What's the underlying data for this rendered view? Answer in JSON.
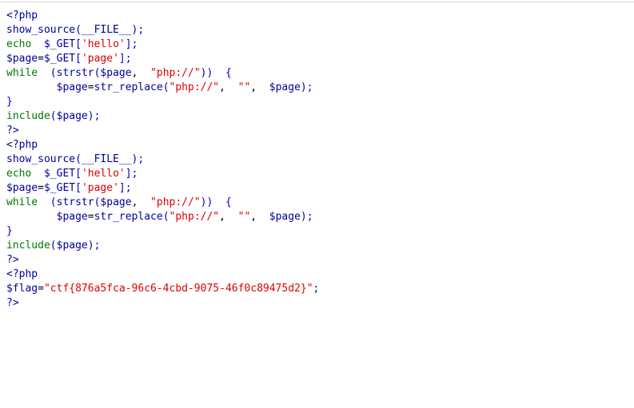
{
  "page": {
    "background_color": "#ffffff",
    "top_rule_color": "#d9d9d9"
  },
  "syntax_colors": {
    "php_tag": "#000099",
    "keyword": "#007700",
    "string": "#DD0000",
    "default": "#000099",
    "punctuation": "#0000BB",
    "plain": "#000000"
  },
  "source": {
    "language": "php",
    "flag": "ctf{876a5fca-96c6-4cbd-9075-46f0c89475d2}",
    "lines": [
      {
        "name": "php-open-tag-1",
        "tokens": [
          {
            "t": "<?php",
            "c": "tag"
          }
        ]
      },
      {
        "name": "show-source-call-1",
        "tokens": [
          {
            "t": "show_source",
            "c": "default"
          },
          {
            "t": "(",
            "c": "punct"
          },
          {
            "t": "__FILE__",
            "c": "default"
          },
          {
            "t": ")",
            "c": "punct"
          },
          {
            "t": ";",
            "c": "punct"
          }
        ]
      },
      {
        "name": "echo-hello-1",
        "tokens": [
          {
            "t": "echo ",
            "c": "keyword"
          },
          {
            "t": " ",
            "c": "plain"
          },
          {
            "t": "$_GET",
            "c": "default"
          },
          {
            "t": "[",
            "c": "punct"
          },
          {
            "t": "'hello'",
            "c": "string"
          },
          {
            "t": "]",
            "c": "punct"
          },
          {
            "t": ";",
            "c": "punct"
          }
        ]
      },
      {
        "name": "assign-page-1",
        "tokens": [
          {
            "t": "$page",
            "c": "default"
          },
          {
            "t": "=",
            "c": "plain"
          },
          {
            "t": "$_GET",
            "c": "default"
          },
          {
            "t": "[",
            "c": "punct"
          },
          {
            "t": "'page'",
            "c": "string"
          },
          {
            "t": "]",
            "c": "punct"
          },
          {
            "t": ";",
            "c": "punct"
          }
        ]
      },
      {
        "name": "while-strstr-1",
        "tokens": [
          {
            "t": "while",
            "c": "keyword"
          },
          {
            "t": " ",
            "c": "plain"
          },
          {
            "t": " (",
            "c": "punct"
          },
          {
            "t": "strstr",
            "c": "default"
          },
          {
            "t": "(",
            "c": "punct"
          },
          {
            "t": "$page",
            "c": "default"
          },
          {
            "t": ",",
            "c": "plain"
          },
          {
            "t": "  ",
            "c": "plain"
          },
          {
            "t": "\"php://\"",
            "c": "string"
          },
          {
            "t": "))",
            "c": "punct"
          },
          {
            "t": "  ",
            "c": "plain"
          },
          {
            "t": "{",
            "c": "punct"
          }
        ]
      },
      {
        "name": "str-replace-1",
        "indent": 4,
        "tokens": [
          {
            "t": "$page",
            "c": "default"
          },
          {
            "t": "=",
            "c": "plain"
          },
          {
            "t": "str_replace",
            "c": "default"
          },
          {
            "t": "(",
            "c": "punct"
          },
          {
            "t": "\"php://\"",
            "c": "string"
          },
          {
            "t": ",",
            "c": "plain"
          },
          {
            "t": "  ",
            "c": "plain"
          },
          {
            "t": "\"\"",
            "c": "string"
          },
          {
            "t": ",",
            "c": "plain"
          },
          {
            "t": "  ",
            "c": "plain"
          },
          {
            "t": "$page",
            "c": "default"
          },
          {
            "t": ")",
            "c": "punct"
          },
          {
            "t": ";",
            "c": "punct"
          }
        ]
      },
      {
        "name": "close-brace-1",
        "tokens": [
          {
            "t": "}",
            "c": "punct"
          }
        ]
      },
      {
        "name": "include-page-1",
        "tokens": [
          {
            "t": "include",
            "c": "keyword"
          },
          {
            "t": "(",
            "c": "punct"
          },
          {
            "t": "$page",
            "c": "default"
          },
          {
            "t": ")",
            "c": "punct"
          },
          {
            "t": ";",
            "c": "punct"
          }
        ]
      },
      {
        "name": "php-close-tag-1",
        "tokens": [
          {
            "t": "?>",
            "c": "tag"
          }
        ]
      },
      {
        "name": "php-open-tag-2",
        "tokens": [
          {
            "t": "<?php",
            "c": "tag"
          }
        ]
      },
      {
        "name": "show-source-call-2",
        "tokens": [
          {
            "t": "show_source",
            "c": "default"
          },
          {
            "t": "(",
            "c": "punct"
          },
          {
            "t": "__FILE__",
            "c": "default"
          },
          {
            "t": ")",
            "c": "punct"
          },
          {
            "t": ";",
            "c": "punct"
          }
        ]
      },
      {
        "name": "echo-hello-2",
        "tokens": [
          {
            "t": "echo ",
            "c": "keyword"
          },
          {
            "t": " ",
            "c": "plain"
          },
          {
            "t": "$_GET",
            "c": "default"
          },
          {
            "t": "[",
            "c": "punct"
          },
          {
            "t": "'hello'",
            "c": "string"
          },
          {
            "t": "]",
            "c": "punct"
          },
          {
            "t": ";",
            "c": "punct"
          }
        ]
      },
      {
        "name": "assign-page-2",
        "tokens": [
          {
            "t": "$page",
            "c": "default"
          },
          {
            "t": "=",
            "c": "plain"
          },
          {
            "t": "$_GET",
            "c": "default"
          },
          {
            "t": "[",
            "c": "punct"
          },
          {
            "t": "'page'",
            "c": "string"
          },
          {
            "t": "]",
            "c": "punct"
          },
          {
            "t": ";",
            "c": "punct"
          }
        ]
      },
      {
        "name": "while-strstr-2",
        "tokens": [
          {
            "t": "while",
            "c": "keyword"
          },
          {
            "t": " ",
            "c": "plain"
          },
          {
            "t": " (",
            "c": "punct"
          },
          {
            "t": "strstr",
            "c": "default"
          },
          {
            "t": "(",
            "c": "punct"
          },
          {
            "t": "$page",
            "c": "default"
          },
          {
            "t": ",",
            "c": "plain"
          },
          {
            "t": "  ",
            "c": "plain"
          },
          {
            "t": "\"php://\"",
            "c": "string"
          },
          {
            "t": "))",
            "c": "punct"
          },
          {
            "t": "  ",
            "c": "plain"
          },
          {
            "t": "{",
            "c": "punct"
          }
        ]
      },
      {
        "name": "str-replace-2",
        "indent": 4,
        "tokens": [
          {
            "t": "$page",
            "c": "default"
          },
          {
            "t": "=",
            "c": "plain"
          },
          {
            "t": "str_replace",
            "c": "default"
          },
          {
            "t": "(",
            "c": "punct"
          },
          {
            "t": "\"php://\"",
            "c": "string"
          },
          {
            "t": ",",
            "c": "plain"
          },
          {
            "t": "  ",
            "c": "plain"
          },
          {
            "t": "\"\"",
            "c": "string"
          },
          {
            "t": ",",
            "c": "plain"
          },
          {
            "t": "  ",
            "c": "plain"
          },
          {
            "t": "$page",
            "c": "default"
          },
          {
            "t": ")",
            "c": "punct"
          },
          {
            "t": ";",
            "c": "punct"
          }
        ]
      },
      {
        "name": "close-brace-2",
        "tokens": [
          {
            "t": "}",
            "c": "punct"
          }
        ]
      },
      {
        "name": "include-page-2",
        "tokens": [
          {
            "t": "include",
            "c": "keyword"
          },
          {
            "t": "(",
            "c": "punct"
          },
          {
            "t": "$page",
            "c": "default"
          },
          {
            "t": ")",
            "c": "punct"
          },
          {
            "t": ";",
            "c": "punct"
          }
        ]
      },
      {
        "name": "php-close-tag-2",
        "tokens": [
          {
            "t": "?>",
            "c": "tag"
          }
        ]
      },
      {
        "name": "php-open-tag-3",
        "tokens": [
          {
            "t": "<?php",
            "c": "tag"
          }
        ]
      },
      {
        "name": "flag-assignment",
        "tokens": [
          {
            "t": "$flag",
            "c": "default"
          },
          {
            "t": "=",
            "c": "plain"
          },
          {
            "t": "\"ctf{876a5fca-96c6-4cbd-9075-46f0c89475d2}\"",
            "c": "string"
          },
          {
            "t": ";",
            "c": "punct"
          }
        ]
      },
      {
        "name": "php-close-tag-3",
        "tokens": [
          {
            "t": "?>",
            "c": "tag"
          }
        ]
      }
    ]
  }
}
